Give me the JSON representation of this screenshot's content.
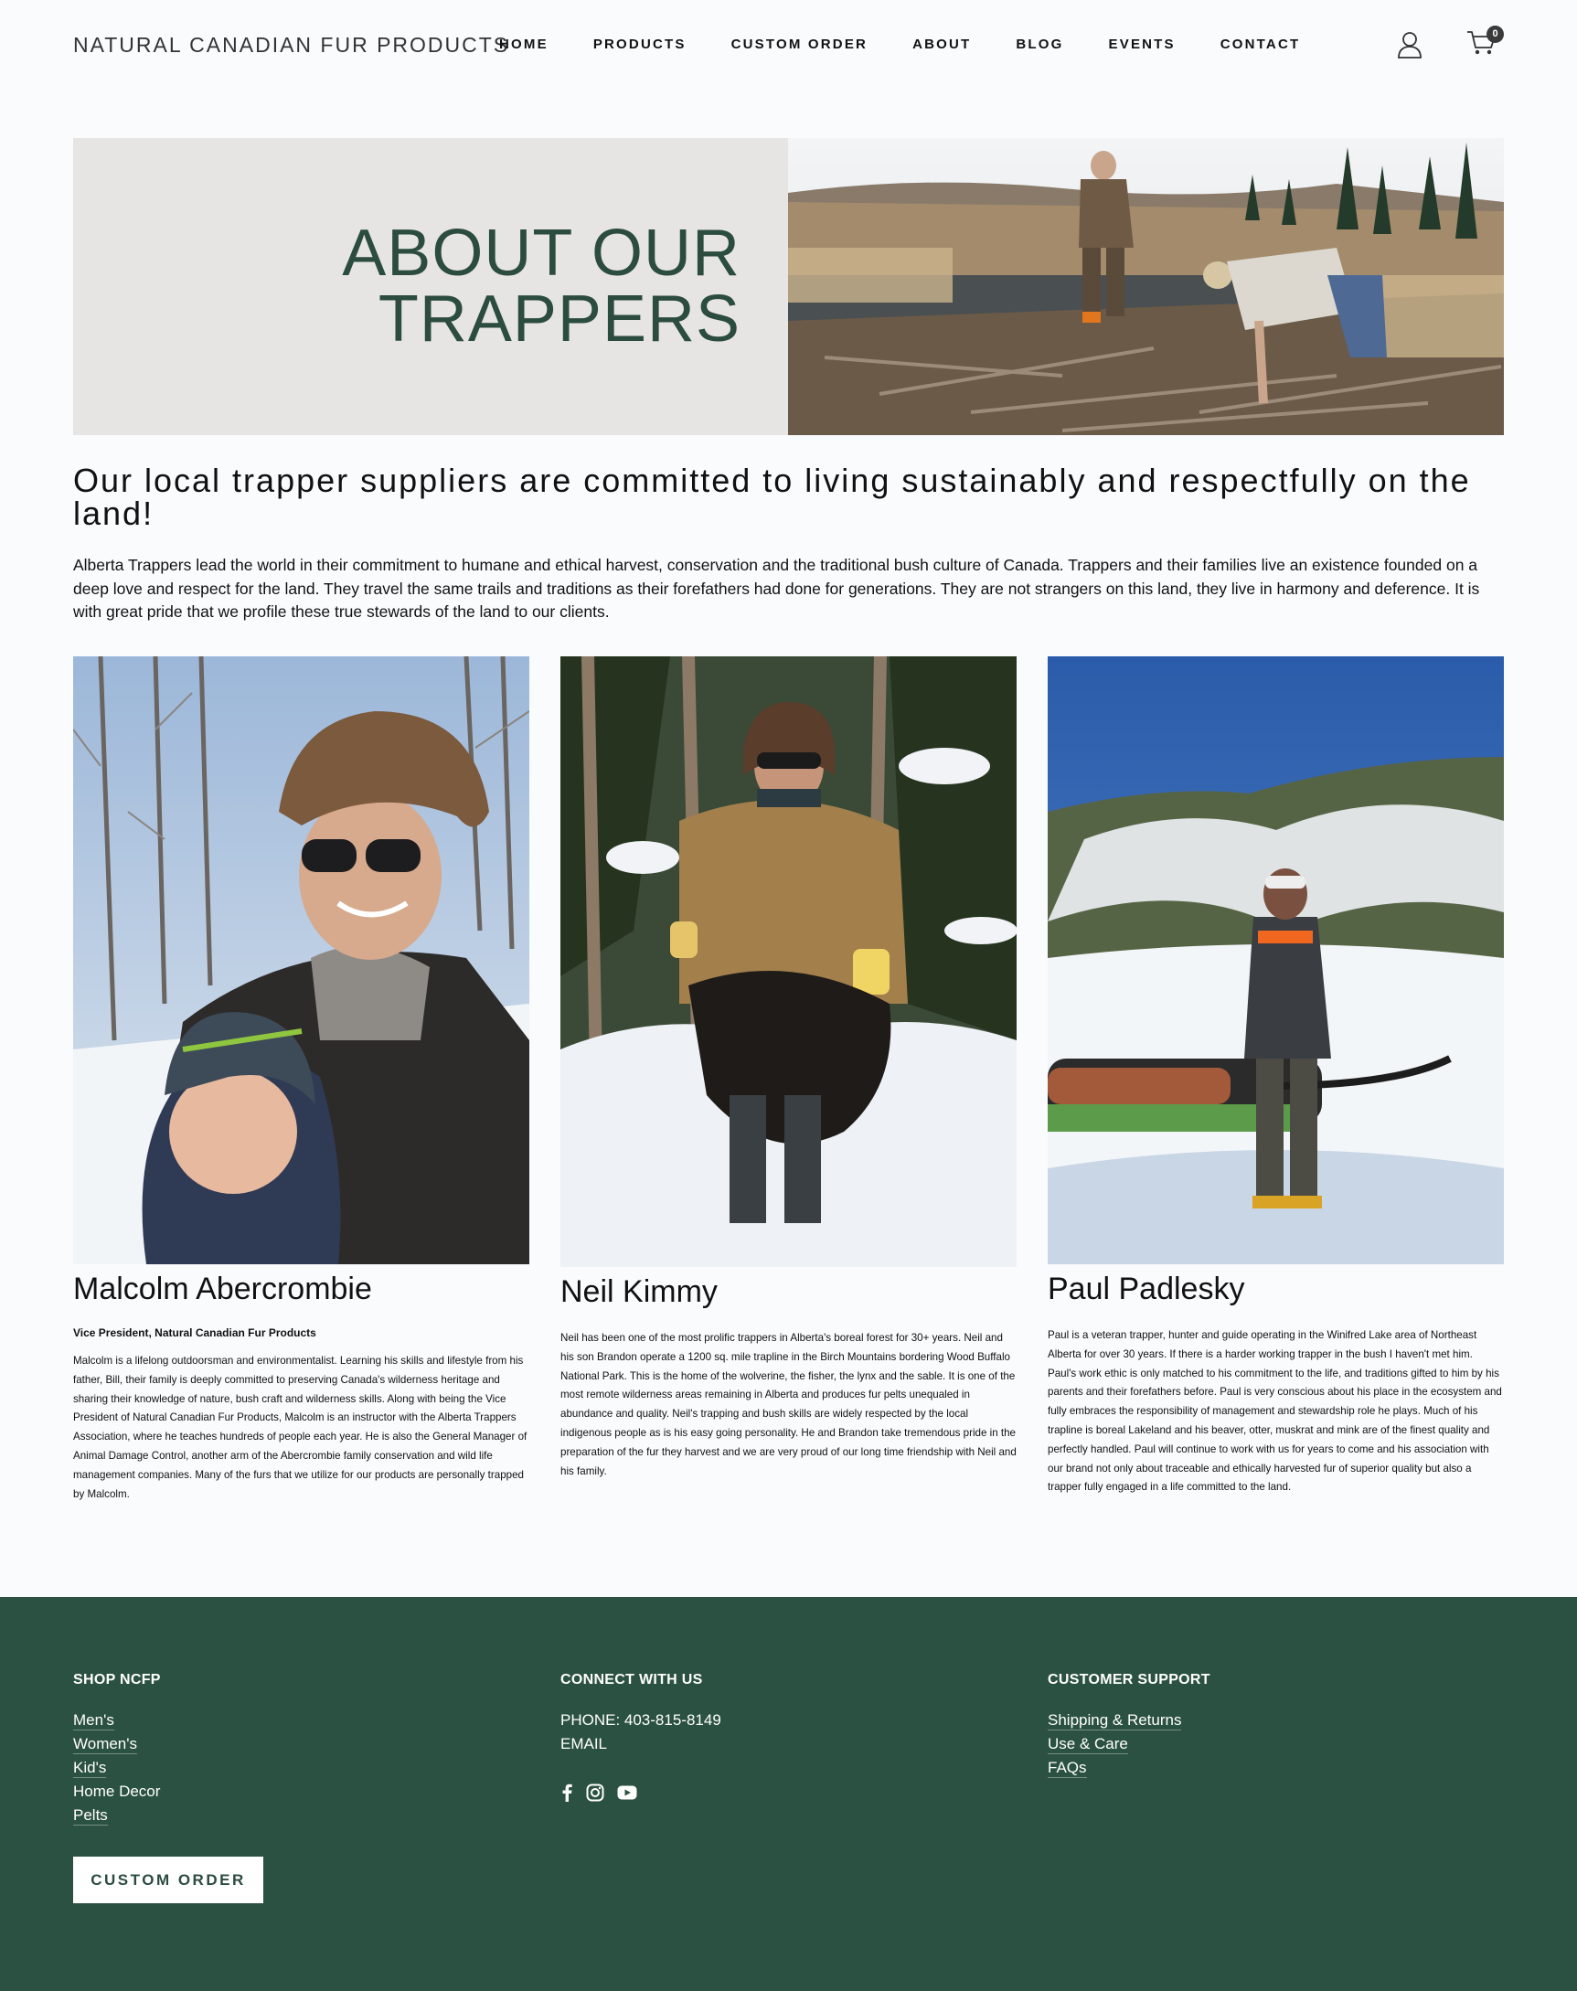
{
  "header": {
    "logo": "NATURAL CANADIAN FUR PRODUCTS",
    "nav": [
      "HOME",
      "PRODUCTS",
      "CUSTOM ORDER",
      "ABOUT",
      "BLOG",
      "EVENTS",
      "CONTACT"
    ],
    "cart_count": "0",
    "icons": [
      "user-icon",
      "cart-icon"
    ]
  },
  "hero": {
    "title_line1": "ABOUT OUR",
    "title_line2": "TRAPPERS",
    "title_color": "#2b4c3f",
    "panel_color": "#e7e5e3"
  },
  "intro": {
    "heading": "Our local trapper suppliers are committed to living sustainably and respectfully on the land!",
    "body": "Alberta Trappers lead the world in their commitment to humane and ethical harvest, conservation and the traditional bush culture of Canada. Trappers and their families live an existence founded on a deep love and respect for the land. They travel the same trails and traditions as their forefathers had done for generations. They are not strangers on this land, they live in harmony and deference. It is with great pride that we profile these true stewards of the land to our clients."
  },
  "trappers": [
    {
      "name": "Malcolm Abercrombie",
      "role": "Vice President, Natural Canadian Fur Products",
      "bio": "Malcolm is a lifelong outdoorsman and environmentalist. Learning his skills and lifestyle from his father, Bill, their family is deeply committed to preserving Canada's wilderness heritage and sharing their knowledge of nature, bush craft and wilderness skills. Along with being the Vice President of Natural Canadian Fur Products, Malcolm is an instructor with the Alberta Trappers Association, where he teaches hundreds of people each year. He is also the General Manager of Animal Damage Control, another arm of the Abercrombie family conservation and wild life management companies. Many of the furs that we utilize for our products are personally trapped by Malcolm."
    },
    {
      "name": "Neil Kimmy",
      "role": "",
      "bio": "Neil has been one of the most prolific trappers in Alberta's boreal forest for 30+ years. Neil and his son Brandon operate a 1200 sq. mile trapline in the Birch Mountains bordering Wood Buffalo National Park. This is the home of the wolverine, the fisher, the lynx and the sable. It is one of the most remote wilderness areas remaining in Alberta and produces fur pelts unequaled in abundance and quality. Neil's trapping and bush skills are widely respected by the local indigenous people as is his easy going personality. He and Brandon take tremendous pride in the preparation of the fur they harvest and we are very proud of our long time friendship with Neil and his family."
    },
    {
      "name": "Paul Padlesky",
      "role": "",
      "bio": "Paul is a veteran trapper, hunter and guide operating in the Winifred Lake area of Northeast Alberta for over 30 years. If there is a harder working trapper in the bush I haven't met him. Paul's work ethic is only matched to his commitment to the life, and traditions gifted to him by his parents and their forefathers before. Paul is very conscious about his place in the ecosystem and fully embraces the responsibility of management and stewardship role he plays. Much of his trapline is boreal Lakeland and his beaver, otter, muskrat and mink are of the finest quality and perfectly handled. Paul will continue to work with us for years to come and his association with our brand not only about traceable and ethically harvested fur of superior quality but also a trapper fully engaged in a life committed to the land."
    }
  ],
  "footer": {
    "bg_color": "#2b5142",
    "shop": {
      "heading": "SHOP NCFP",
      "links": [
        "Men's",
        "Women's",
        "Kid's",
        "Home Decor",
        "Pelts"
      ],
      "button": "CUSTOM ORDER"
    },
    "connect": {
      "heading": "CONNECT WITH US",
      "phone": "PHONE: 403-815-8149",
      "email": "EMAIL",
      "socials": [
        "facebook-icon",
        "instagram-icon",
        "youtube-icon"
      ]
    },
    "support": {
      "heading": "CUSTOMER SUPPORT",
      "links": [
        "Shipping & Returns",
        "Use & Care",
        "FAQs"
      ]
    }
  }
}
